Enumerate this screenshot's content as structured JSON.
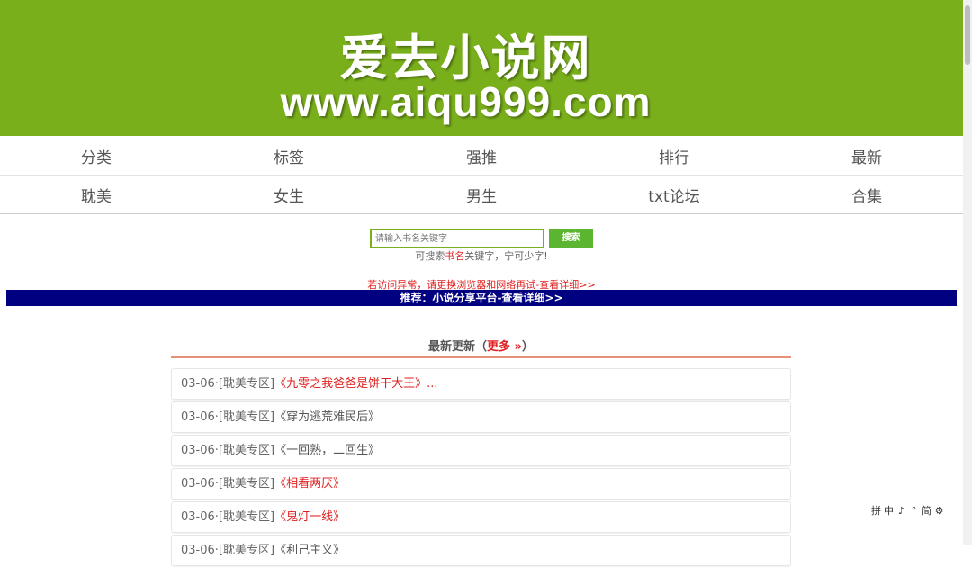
{
  "banner": {
    "title": "爱去小说网",
    "url": "www.aiqu999.com",
    "color": "#7aaf1c"
  },
  "nav": {
    "row1": [
      "分类",
      "标签",
      "强推",
      "排行",
      "最新"
    ],
    "row2": [
      "耽美",
      "女生",
      "男生",
      "txt论坛",
      "合集"
    ]
  },
  "search": {
    "placeholder": "请输入书名关键字",
    "button": "搜索",
    "hint_prefix": "可搜索",
    "hint_highlight": "书名",
    "hint_suffix": "关键字，宁可少字!"
  },
  "notice": "若访问异常，请更换浏览器和网络再试-查看详细>>",
  "recommend": "推荐：小说分享平台-查看详细>>",
  "latest": {
    "heading": "最新更新（",
    "more": "更多 »",
    "heading_close": "）",
    "items": [
      {
        "date": "03-06·",
        "category": "[耽美专区]",
        "title": "《九零之我爸爸是饼干大王》...",
        "hot": true
      },
      {
        "date": "03-06·",
        "category": "[耽美专区]",
        "title": "《穿为逃荒难民后》",
        "hot": false
      },
      {
        "date": "03-06·",
        "category": "[耽美专区]",
        "title": "《一回熟，二回生》",
        "hot": false
      },
      {
        "date": "03-06·",
        "category": "[耽美专区]",
        "title": "《相看两厌》",
        "hot": true
      },
      {
        "date": "03-06·",
        "category": "[耽美专区]",
        "title": "《鬼灯一线》",
        "hot": true
      },
      {
        "date": "03-06·",
        "category": "[耽美专区]",
        "title": "《利己主义》",
        "hot": false
      }
    ]
  },
  "ime_toolbar": [
    "拼",
    "中",
    "♪",
    "°",
    "简",
    "⚙"
  ]
}
